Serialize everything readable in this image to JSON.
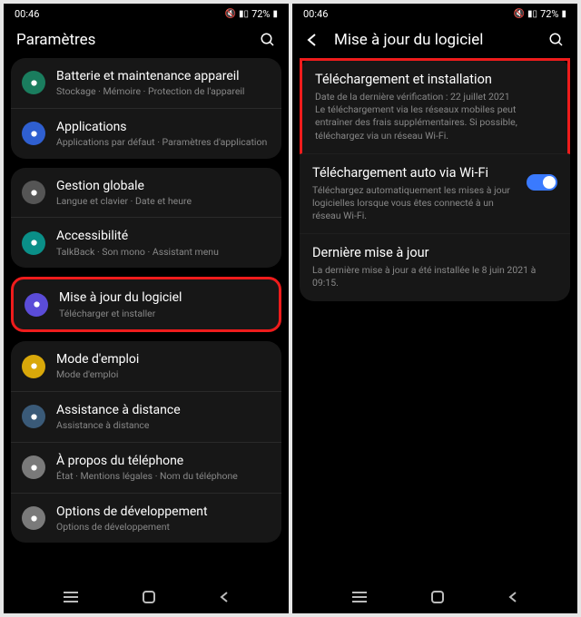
{
  "status": {
    "time": "00:46",
    "battery": "72%"
  },
  "left": {
    "title": "Paramètres",
    "group1": [
      {
        "title": "Batterie et maintenance appareil",
        "sub": "Stockage · Mémoire · Protection de l'appareil",
        "iconClass": "ic-bg-green",
        "name": "battery-maintenance"
      },
      {
        "title": "Applications",
        "sub": "Applications par défaut · Paramètres d'application",
        "iconClass": "ic-bg-blue",
        "name": "applications"
      }
    ],
    "group2": [
      {
        "title": "Gestion globale",
        "sub": "Langue et clavier · Date et heure",
        "iconClass": "ic-bg-gray",
        "name": "global-management"
      },
      {
        "title": "Accessibilité",
        "sub": "TalkBack · Son mono · Assistant menu",
        "iconClass": "ic-bg-teal",
        "name": "accessibility"
      }
    ],
    "group3": [
      {
        "title": "Mise à jour du logiciel",
        "sub": "Télécharger et installer",
        "iconClass": "ic-bg-purple",
        "name": "software-update",
        "highlight": true
      },
      {
        "title": "Mode d'emploi",
        "sub": "Mode d'emploi",
        "iconClass": "ic-bg-yellow",
        "name": "user-manual"
      },
      {
        "title": "Assistance à distance",
        "sub": "Assistance à distance",
        "iconClass": "ic-bg-info",
        "name": "remote-assistance"
      },
      {
        "title": "À propos du téléphone",
        "sub": "État · Mentions légales · Nom du téléphone",
        "iconClass": "ic-bg-lgray",
        "name": "about-phone"
      },
      {
        "title": "Options de développement",
        "sub": "Options de développement",
        "iconClass": "ic-bg-lgray",
        "name": "developer-options"
      }
    ]
  },
  "right": {
    "title": "Mise à jour du logiciel",
    "items": [
      {
        "title": "Téléchargement et installation",
        "sub": "Date de la dernière vérification : 22 juillet 2021\nLe téléchargement via les réseaux mobiles peut entraîner des frais supplémentaires. Si possible, téléchargez via un réseau Wi-Fi.",
        "highlight": true,
        "name": "download-install"
      },
      {
        "title": "Téléchargement auto via Wi-Fi",
        "sub": "Téléchargez automatiquement les mises à jour logicielles lorsque vous êtes connecté à un réseau Wi-Fi.",
        "toggle": true,
        "name": "auto-download-wifi"
      },
      {
        "title": "Dernière mise à jour",
        "sub": "La dernière mise à jour a été installée le 8 juin 2021 à 09:15.",
        "name": "last-update"
      }
    ]
  }
}
